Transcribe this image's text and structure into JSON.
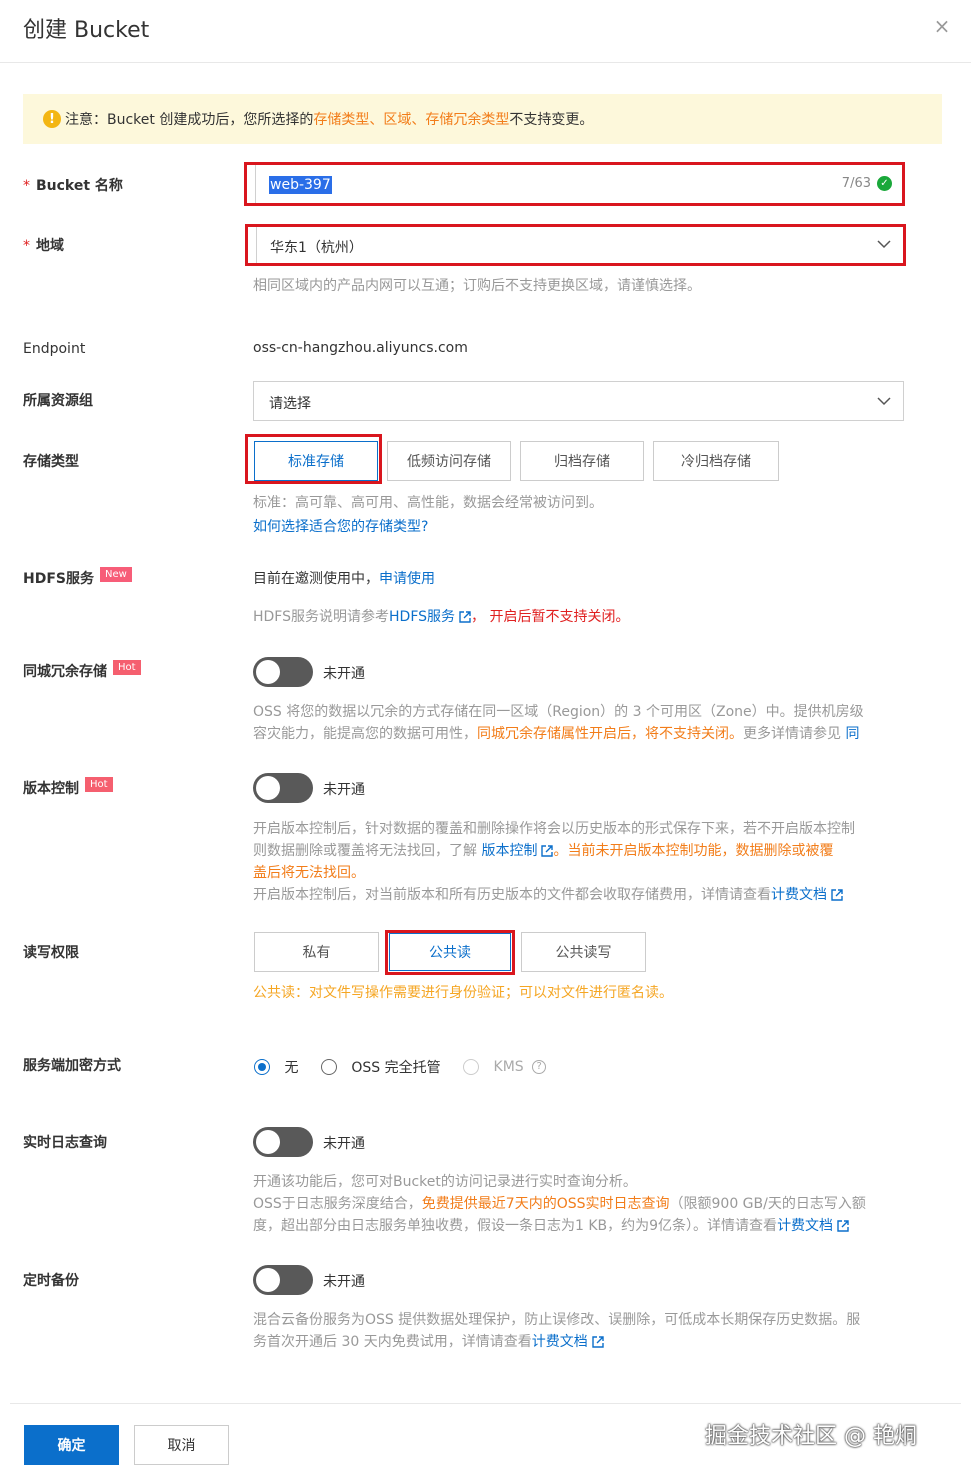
{
  "dialog": {
    "title": "创建 Bucket",
    "close": "×"
  },
  "notice": {
    "prefix": "注意：Bucket 创建成功后，您所选择的 ",
    "t1": "存储类型",
    "sep1": "、",
    "t2": "区域",
    "sep2": "、",
    "t3": "存储冗余类型",
    "suffix": " 不支持变更。"
  },
  "bucket_name": {
    "label": "Bucket 名称",
    "value": "web-397",
    "counter": "7/63"
  },
  "region": {
    "label": "地域",
    "value": "华东1（杭州）",
    "help": "相同区域内的产品内网可以互通；订购后不支持更换区域，请谨慎选择。"
  },
  "endpoint": {
    "label": "Endpoint",
    "value": "oss-cn-hangzhou.aliyuncs.com"
  },
  "resource_group": {
    "label": "所属资源组",
    "placeholder": "请选择"
  },
  "storage_class": {
    "label": "存储类型",
    "options": [
      "标准存储",
      "低频访问存储",
      "归档存储",
      "冷归档存储"
    ],
    "selected": "标准存储",
    "help": "标准：高可靠、高可用、高性能，数据会经常被访问到。",
    "link": "如何选择适合您的存储类型?"
  },
  "hdfs": {
    "label": "HDFS服务",
    "badge": "New",
    "status": "目前在邀测使用中，",
    "apply_link": "申请使用",
    "help_prefix": "HDFS服务说明请参考",
    "help_link": "HDFS服务",
    "help_sep": "，",
    "help_warn": "开启后暂不支持关闭。"
  },
  "zrs": {
    "label": "同城冗余存储",
    "badge": "Hot",
    "state": "未开通",
    "help1": "OSS 将您的数据以冗余的方式存储在同一区域（Region）的 3 个可用区（Zone）中。提供机房级",
    "help2a": "容灾能力，能提高您的数据可用性，",
    "help2b": "同城冗余存储属性开启后，将不支持关闭。",
    "help2c": "更多详情请参见 ",
    "help2d": "同"
  },
  "versioning": {
    "label": "版本控制",
    "badge": "Hot",
    "state": "未开通",
    "help1": "开启版本控制后，针对数据的覆盖和删除操作将会以历史版本的形式保存下来，若不开启版本控制",
    "help2a": "则数据删除或覆盖将无法找回，了解 ",
    "help2b": "版本控制",
    "help2c": "。当前未开启版本控制功能，数据删除或被覆",
    "help3": "盖后将无法找回。",
    "help4a": "开启版本控制后，对当前版本和所有历史版本的文件都会收取存储费用，详情请查看",
    "help4b": "计费文档"
  },
  "acl": {
    "label": "读写权限",
    "options": [
      "私有",
      "公共读",
      "公共读写"
    ],
    "selected": "公共读",
    "help": "公共读：对文件写操作需要进行身份验证；可以对文件进行匿名读。"
  },
  "encryption": {
    "label": "服务端加密方式",
    "options": [
      "无",
      "OSS 完全托管",
      "KMS"
    ],
    "selected": "无"
  },
  "realtime_log": {
    "label": "实时日志查询",
    "state": "未开通",
    "help1": "开通该功能后，您可对Bucket的访问记录进行实时查询分析。",
    "help2a": "OSS于日志服务深度结合，",
    "help2b": "免费提供最近7天内的OSS实时日志查询",
    "help2c": "（限额900 GB/天的日志写入额",
    "help3a": "度，超出部分由日志服务单独收费，假设一条日志为1 KB，约为9亿条）。详情请查看",
    "help3b": "计费文档"
  },
  "backup": {
    "label": "定时备份",
    "state": "未开通",
    "help1": "混合云备份服务为OSS 提供数据处理保护，防止误修改、误删除，可低成本长期保存历史数据。服",
    "help2a": "务首次开通后 30 天内免费试用，详情请查看",
    "help2b": "计费文档"
  },
  "footer": {
    "confirm": "确定",
    "cancel": "取消"
  },
  "watermark": "掘金技术社区 @ 艳烔",
  "colors": {
    "primary": "#0b6fcb",
    "highlight": "#d9161e",
    "warning": "#f27d1a",
    "notice_bg": "#fdf8db"
  }
}
